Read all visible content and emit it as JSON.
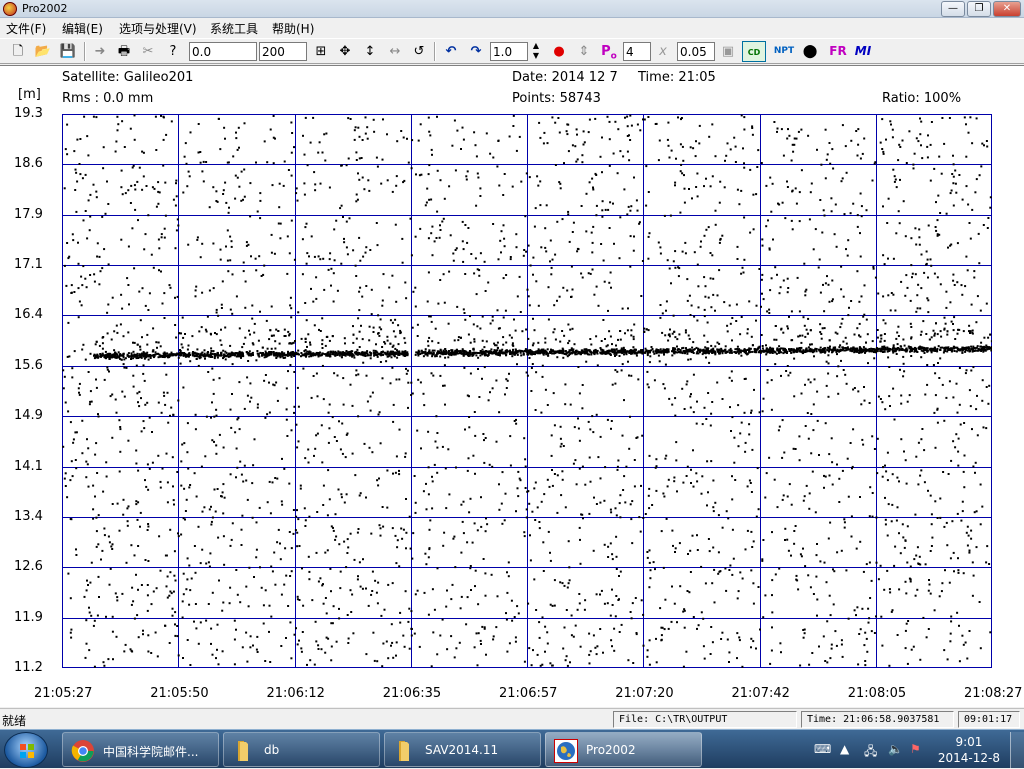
{
  "window": {
    "title": "Pro2002",
    "minimize_glyph": "—",
    "restore_glyph": "❐",
    "close_glyph": "✕"
  },
  "menu": [
    "文件(F)",
    "编辑(E)",
    "选项与处理(V)",
    "系统工具",
    "帮助(H)"
  ],
  "toolbar": {
    "field_start": "0.0",
    "field_span": "200",
    "field_scale": "1.0",
    "field_p0": "4",
    "field_threshold": "0.05",
    "p0_label": "P",
    "p0_sub": "o",
    "cd_label": "CD",
    "npt_label": "NPT",
    "fr_label": "FR",
    "mi_label": "MI",
    "x_label": "x"
  },
  "plot_header": {
    "satellite": "Satellite: Galileo201",
    "rms": "Rms :   0.0 mm",
    "date": "Date: 2014 12  7",
    "time": "Time: 21:05",
    "points": "Points: 58743",
    "ratio": "Ratio: 100%",
    "y_unit": "[m]"
  },
  "chart_data": {
    "type": "scatter",
    "title": "",
    "xlabel": "",
    "ylabel": "[m]",
    "x_ticks": [
      "21:05:27",
      "21:05:50",
      "21:06:12",
      "21:06:35",
      "21:06:57",
      "21:07:20",
      "21:07:42",
      "21:08:05",
      "21:08:27"
    ],
    "y_ticks": [
      "19.3",
      "18.6",
      "17.9",
      "17.1",
      "16.4",
      "15.6",
      "14.9",
      "14.1",
      "13.4",
      "12.6",
      "11.9",
      "11.2"
    ],
    "ylim": [
      11.2,
      19.3
    ],
    "xlim": [
      "21:05:27",
      "21:08:27"
    ],
    "grid": true,
    "grid_color": "#0000aa",
    "point_color": "#000000",
    "signal_track": {
      "description_value_start": 15.78,
      "description_value_end": 15.88,
      "time_start": "21:05:33",
      "time_end": "21:08:27"
    }
  },
  "status": {
    "ready": "就绪",
    "file": "File: C:\\TR\\OUTPUT",
    "time": "Time: 21:06:58.9037581",
    "clock": "09:01:17"
  },
  "taskbar": {
    "items": [
      {
        "label": "中国科学院邮件...",
        "icon": "chrome-icon"
      },
      {
        "label": "db",
        "icon": "folder-icon"
      },
      {
        "label": "SAV2014.11",
        "icon": "folder-icon"
      },
      {
        "label": "Pro2002",
        "icon": "app-icon"
      }
    ],
    "clock_time": "9:01",
    "clock_date": "2014-12-8"
  }
}
